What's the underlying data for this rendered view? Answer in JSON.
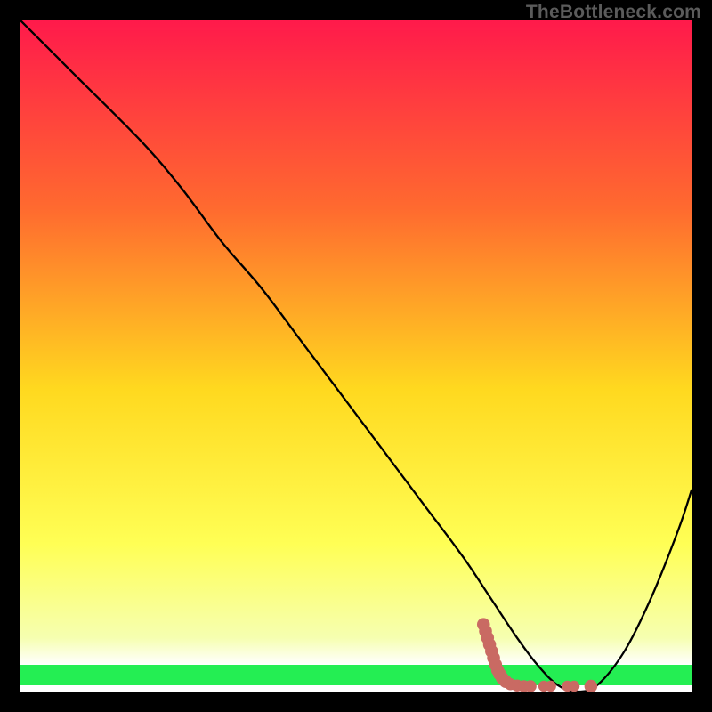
{
  "watermark": "TheBottleneck.com",
  "chart_data": {
    "type": "line",
    "title": "",
    "xlabel": "",
    "ylabel": "",
    "xlim": [
      0,
      100
    ],
    "ylim": [
      0,
      100
    ],
    "background_gradient": {
      "top": "#ff1a4b",
      "upper_mid": "#ff8a2a",
      "mid": "#ffd91f",
      "lower_mid": "#ffff66",
      "green_band": "#24ee53",
      "bottom_band": "#ffffff"
    },
    "series": [
      {
        "name": "bottleneck-curve",
        "x": [
          0,
          8,
          18,
          24,
          30,
          36,
          42,
          48,
          54,
          60,
          66,
          70,
          74,
          77,
          80,
          83,
          86,
          90,
          94,
          98,
          100
        ],
        "y": [
          100,
          92,
          82,
          75,
          67,
          60,
          52,
          44,
          36,
          28,
          20,
          14,
          8,
          4,
          1,
          0,
          1,
          6,
          14,
          24,
          30
        ]
      }
    ],
    "markers": {
      "name": "highlight-dots",
      "color": "#c96a63",
      "points": [
        {
          "x": 69.0,
          "y": 10.0,
          "r": 1.4
        },
        {
          "x": 69.3,
          "y": 9.0,
          "r": 1.4
        },
        {
          "x": 69.6,
          "y": 8.0,
          "r": 1.4
        },
        {
          "x": 69.9,
          "y": 7.0,
          "r": 1.4
        },
        {
          "x": 70.2,
          "y": 6.0,
          "r": 1.4
        },
        {
          "x": 70.5,
          "y": 5.0,
          "r": 1.4
        },
        {
          "x": 70.8,
          "y": 4.0,
          "r": 1.4
        },
        {
          "x": 71.1,
          "y": 3.2,
          "r": 1.4
        },
        {
          "x": 71.4,
          "y": 2.6,
          "r": 1.4
        },
        {
          "x": 71.8,
          "y": 2.0,
          "r": 1.4
        },
        {
          "x": 72.3,
          "y": 1.5,
          "r": 1.4
        },
        {
          "x": 73.0,
          "y": 1.1,
          "r": 1.3
        },
        {
          "x": 74.0,
          "y": 0.9,
          "r": 1.3
        },
        {
          "x": 75.0,
          "y": 0.8,
          "r": 1.3
        },
        {
          "x": 76.0,
          "y": 0.8,
          "r": 1.3
        },
        {
          "x": 78.0,
          "y": 0.8,
          "r": 1.2
        },
        {
          "x": 79.0,
          "y": 0.8,
          "r": 1.2
        },
        {
          "x": 81.5,
          "y": 0.8,
          "r": 1.2
        },
        {
          "x": 82.5,
          "y": 0.8,
          "r": 1.2
        },
        {
          "x": 85.0,
          "y": 0.8,
          "r": 1.4
        }
      ]
    }
  }
}
